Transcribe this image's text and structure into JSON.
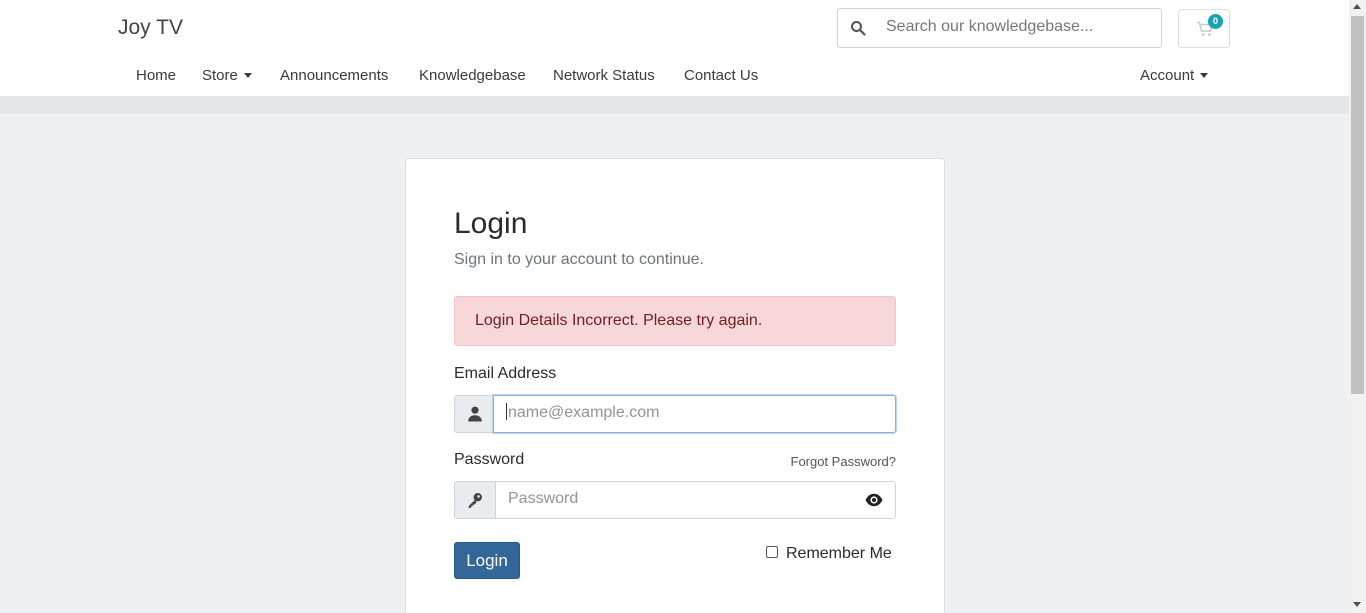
{
  "header": {
    "brand": "Joy TV",
    "search_placeholder": "Search our knowledgebase...",
    "cart_count": "0"
  },
  "nav": {
    "items": [
      {
        "label": "Home"
      },
      {
        "label": "Store"
      },
      {
        "label": "Announcements"
      },
      {
        "label": "Knowledgebase"
      },
      {
        "label": "Network Status"
      },
      {
        "label": "Contact Us"
      }
    ],
    "account": "Account"
  },
  "login": {
    "title": "Login",
    "subtitle": "Sign in to your account to continue.",
    "alert": "Login Details Incorrect. Please try again.",
    "email_label": "Email Address",
    "email_placeholder": "name@example.com",
    "password_label": "Password",
    "forgot": "Forgot Password?",
    "password_placeholder": "Password",
    "submit": "Login",
    "remember": "Remember Me"
  },
  "colors": {
    "primary": "#336699",
    "alert_bg": "#f8d7da",
    "alert_text": "#721c24",
    "badge": "#17a2b8"
  }
}
